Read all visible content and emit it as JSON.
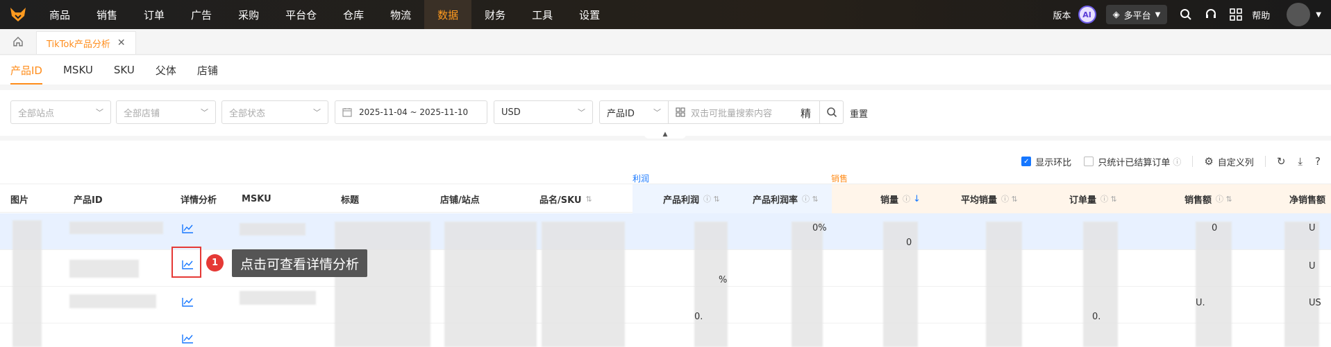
{
  "nav": {
    "menu": [
      "商品",
      "销售",
      "订单",
      "广告",
      "采购",
      "平台仓",
      "仓库",
      "物流",
      "数据",
      "财务",
      "工具",
      "设置"
    ],
    "active": "数据",
    "version": "版本",
    "ai": "AI",
    "platform": "多平台",
    "help": "帮助"
  },
  "tabs": {
    "page_tab": "TikTok产品分析"
  },
  "subtabs": [
    "产品ID",
    "MSKU",
    "SKU",
    "父体",
    "店铺"
  ],
  "filters": {
    "site": "全部站点",
    "store": "全部店铺",
    "status": "全部状态",
    "date_range": "2025-11-04 ~ 2025-11-10",
    "currency": "USD",
    "search_field": "产品ID",
    "search_placeholder": "双击可批量搜索内容",
    "exact": "精",
    "reset": "重置"
  },
  "toolbar": {
    "show_compare": "显示环比",
    "settled_only": "只统计已结算订单",
    "custom_columns": "自定义列"
  },
  "groups": {
    "profit": "利润",
    "sales": "销售"
  },
  "columns": [
    "图片",
    "产品ID",
    "详情分析",
    "MSKU",
    "标题",
    "店铺/站点",
    "品名/SKU",
    "产品利润",
    "产品利润率",
    "销量",
    "平均销量",
    "订单量",
    "销售额",
    "净销售额"
  ],
  "fragments": {
    "r1_rate": "0%",
    "r1_sales_amt": "0",
    "r1_net": "U",
    "r1_qty": "0",
    "r2_net": "U",
    "r2_rate": "%",
    "r3_net": "US",
    "r3_sales_amt": "U.",
    "r3_profit": "0.",
    "r3_orders": "0."
  },
  "annotation": {
    "step": "1",
    "text": "点击可查看详情分析"
  },
  "colors": {
    "accent": "#ff8c1a",
    "link": "#1677ff",
    "annotation": "#e53935"
  }
}
